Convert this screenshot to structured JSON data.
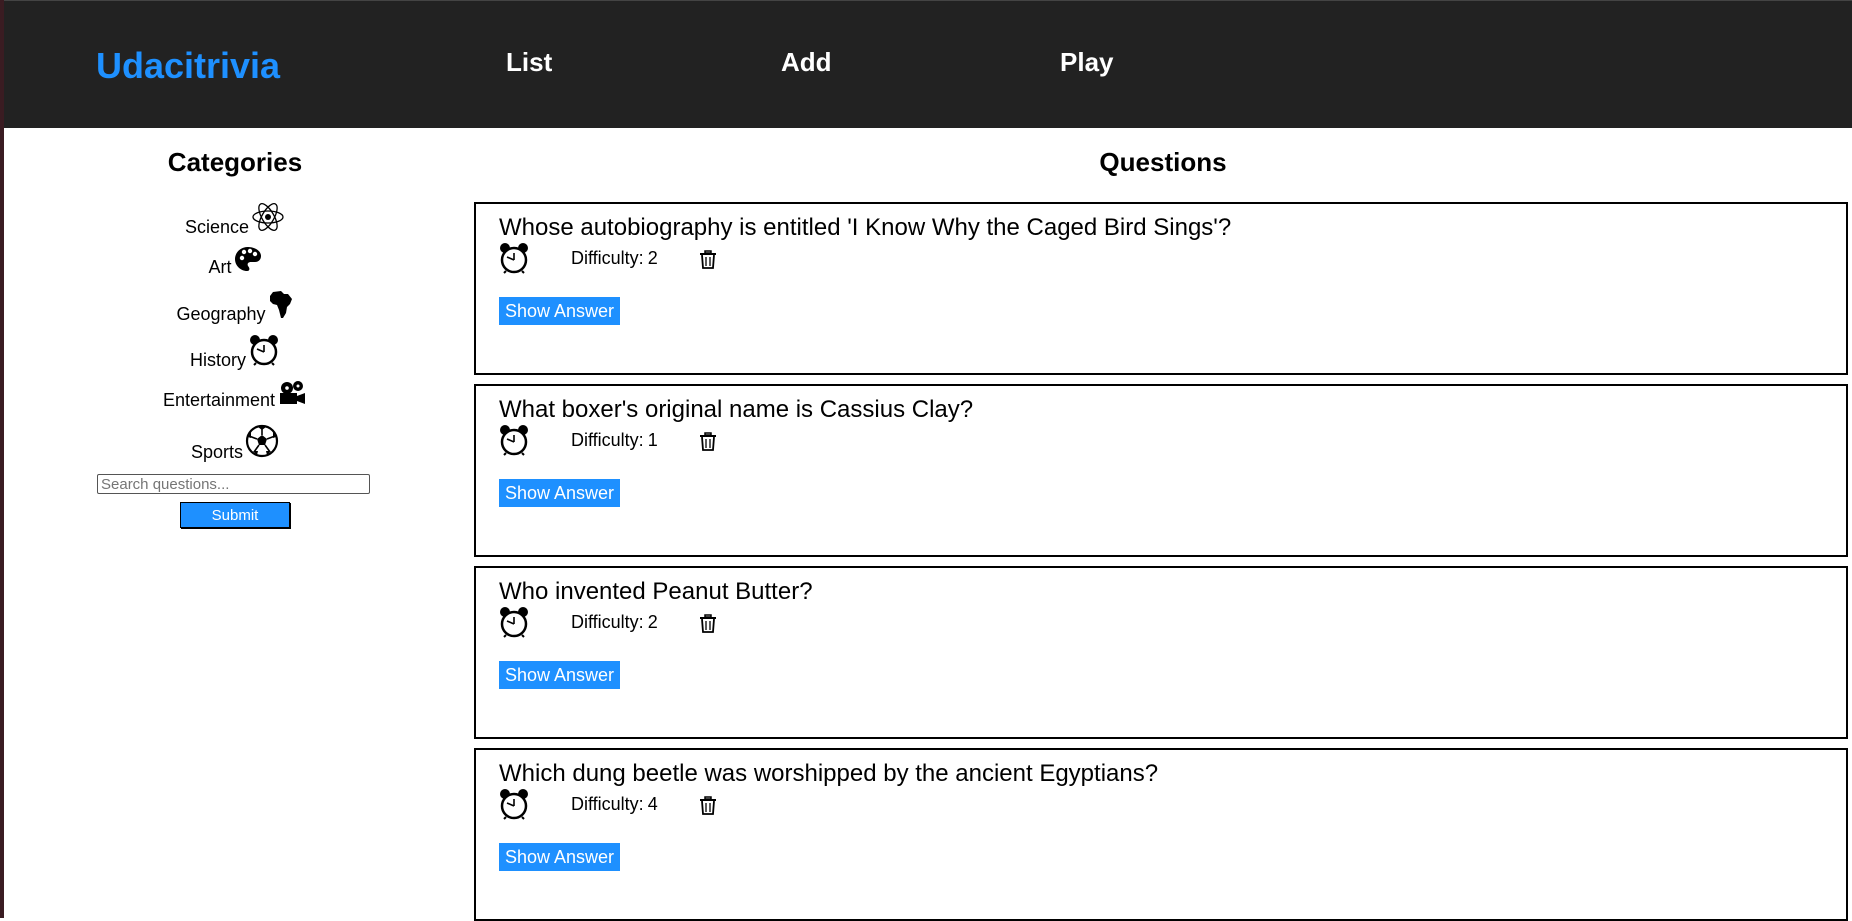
{
  "header": {
    "brand": "Udacitrivia",
    "nav": [
      "List",
      "Add",
      "Play"
    ]
  },
  "colors": {
    "accent": "#1e90ff",
    "navbar": "#222222"
  },
  "sidebar": {
    "title": "Categories",
    "categories": [
      {
        "label": "Science",
        "icon": "atom-icon"
      },
      {
        "label": "Art",
        "icon": "palette-icon"
      },
      {
        "label": "Geography",
        "icon": "africa-icon"
      },
      {
        "label": "History",
        "icon": "alarm-clock-icon"
      },
      {
        "label": "Entertainment",
        "icon": "film-projector-icon"
      },
      {
        "label": "Sports",
        "icon": "soccer-ball-icon"
      }
    ],
    "search": {
      "placeholder": "Search questions...",
      "value": ""
    },
    "submit_label": "Submit"
  },
  "questions": {
    "title": "Questions",
    "difficulty_label": "Difficulty:",
    "show_answer_label": "Show Answer",
    "items": [
      {
        "question": "Whose autobiography is entitled 'I Know Why the Caged Bird Sings'?",
        "difficulty": "2",
        "category_icon": "alarm-clock-icon"
      },
      {
        "question": "What boxer's original name is Cassius Clay?",
        "difficulty": "1",
        "category_icon": "alarm-clock-icon"
      },
      {
        "question": "Who invented Peanut Butter?",
        "difficulty": "2",
        "category_icon": "alarm-clock-icon"
      },
      {
        "question": "Which dung beetle was worshipped by the ancient Egyptians?",
        "difficulty": "4",
        "category_icon": "alarm-clock-icon"
      }
    ]
  }
}
